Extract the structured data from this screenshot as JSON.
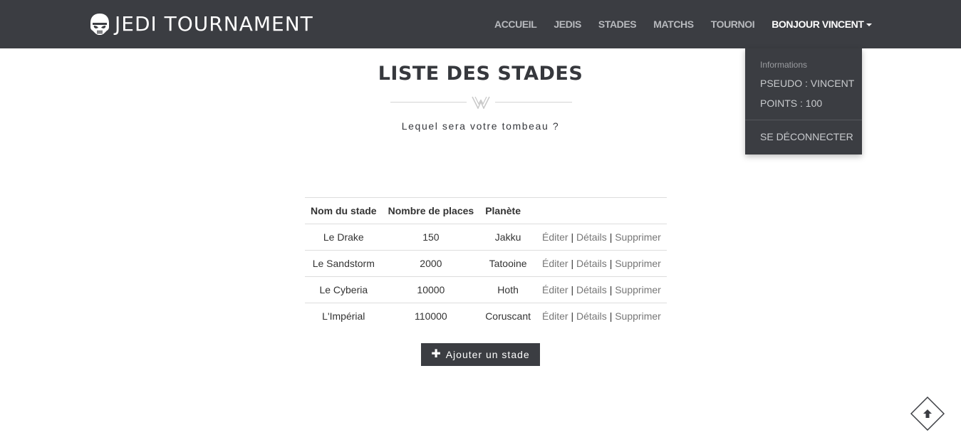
{
  "navbar": {
    "brand": "JEDI TOURNAMENT",
    "brand_icon": "stormtrooper-helmet-icon",
    "links": [
      "ACCUEIL",
      "JEDIS",
      "STADES",
      "MATCHS",
      "TOURNOI"
    ],
    "user_menu_label": "BONJOUR VINCENT",
    "background": "#3b3d42"
  },
  "user_dropdown": {
    "header": "Informations",
    "pseudo": "PSEUDO : VINCENT",
    "points": "POINTS : 100",
    "logout": "SE DÉCONNECTER"
  },
  "page": {
    "title": "LISTE DES STADES",
    "subtitle": "Lequel sera votre tombeau ?"
  },
  "table": {
    "headers": [
      "Nom du stade",
      "Nombre de places",
      "Planète",
      ""
    ],
    "rows": [
      {
        "name": "Le Drake",
        "places": "150",
        "planet": "Jakku"
      },
      {
        "name": "Le Sandstorm",
        "places": "2000",
        "planet": "Tatooine"
      },
      {
        "name": "Le Cyberia",
        "places": "10000",
        "planet": "Hoth"
      },
      {
        "name": "L'Impérial",
        "places": "110000",
        "planet": "Coruscant"
      }
    ],
    "actions": {
      "edit": "Éditer",
      "details": "Détails",
      "delete": "Supprimer",
      "separator": "|"
    }
  },
  "add_button": {
    "label": "Ajouter un stade",
    "icon": "plus-icon"
  },
  "scroll_top": {
    "icon": "arrow-up-icon"
  }
}
